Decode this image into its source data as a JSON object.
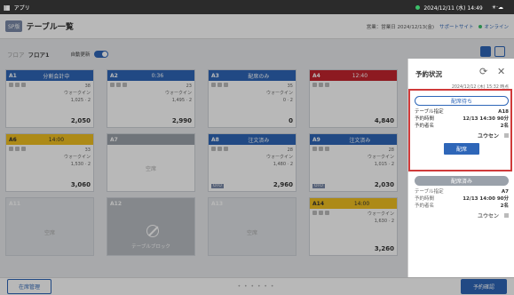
{
  "topbar": {
    "app_name": "アプリ",
    "datetime": "2024/12/11 (水) 14:49",
    "weather": "☀·☁"
  },
  "header": {
    "system_tag": "SP版",
    "title": "テーブル一覧",
    "business_date": "営業：営業日 2024/12/13(金)",
    "support": "サポートサイト",
    "online": "オンライン"
  },
  "floor": {
    "crumb": "フロア",
    "current": "フロア1",
    "auto_refresh_label": "自動更新"
  },
  "tables": [
    {
      "num": "A1",
      "status": "分割会計中",
      "color": "#2e66b8",
      "guests": "38",
      "waiter": "ウォークイン",
      "people": "1,025 · 2",
      "amount": "2,050"
    },
    {
      "num": "A2",
      "status": "0:36",
      "color": "#2e66b8",
      "guests": "23",
      "waiter": "ウォークイン",
      "people": "1,495 · 2",
      "amount": "2,990"
    },
    {
      "num": "A3",
      "status": "配席のみ",
      "color": "#2e66b8",
      "guests": "35",
      "waiter": "ウォークイン",
      "people": "0 · 2",
      "amount": "0"
    },
    {
      "num": "A4",
      "status": "12:40",
      "color": "#c4252f",
      "guests": "",
      "waiter": "",
      "people": "",
      "amount": "4,840"
    },
    {
      "num": "A6",
      "status": "14:00",
      "color": "#f0c020",
      "guests": "33",
      "waiter": "ウォークイン",
      "people": "1,530 · 2",
      "amount": "3,060"
    },
    {
      "num": "A7",
      "status": "",
      "color": "#9aa1aa",
      "empty_label": "空席"
    },
    {
      "num": "A8",
      "status": "注文済み",
      "color": "#2e66b8",
      "guests": "28",
      "waiter": "ウォークイン",
      "people": "1,480 · 2",
      "amount": "2,960",
      "note": "OTO"
    },
    {
      "num": "A9",
      "status": "注文済み",
      "color": "#2e66b8",
      "guests": "28",
      "waiter": "ウォークイン",
      "people": "1,015 · 2",
      "amount": "2,030",
      "note": "OTO"
    },
    {
      "num": "A11",
      "status": "",
      "color": "#d6d9dd",
      "empty_label": "空席"
    },
    {
      "num": "A12",
      "status": "",
      "color": "#b9bdc3",
      "block_label": "テーブルブロック"
    },
    {
      "num": "A13",
      "status": "",
      "color": "#d6d9dd",
      "empty_label": "空席"
    },
    {
      "num": "A14",
      "status": "14:00",
      "color": "#f0c020",
      "guests": "",
      "waiter": "ウォークイン",
      "people": "1,630 · 2",
      "amount": "3,260"
    }
  ],
  "footer": {
    "left_btn": "在席管理",
    "pager": "• • • • • •",
    "right_btn": "予約確認"
  },
  "panel": {
    "title": "予約状況",
    "reload_icon": "⟳",
    "close_icon": "✕",
    "timestamp": "2024/12/12 (木) 15:32 時点",
    "cards": [
      {
        "status": "配席待ち",
        "table_label": "テーブル指定",
        "table_value": "A18",
        "time_label": "予約時間",
        "time_value": "12/13 14:30 90分",
        "name_label": "予約者名",
        "name_value": "2名",
        "guest": "ユウセン",
        "action": "配席"
      },
      {
        "status": "配席済み",
        "table_label": "テーブル指定",
        "table_value": "A7",
        "time_label": "予約時間",
        "time_value": "12/13 14:00 90分",
        "name_label": "予約者名",
        "name_value": "2名",
        "guest": "ユウセン"
      }
    ]
  }
}
